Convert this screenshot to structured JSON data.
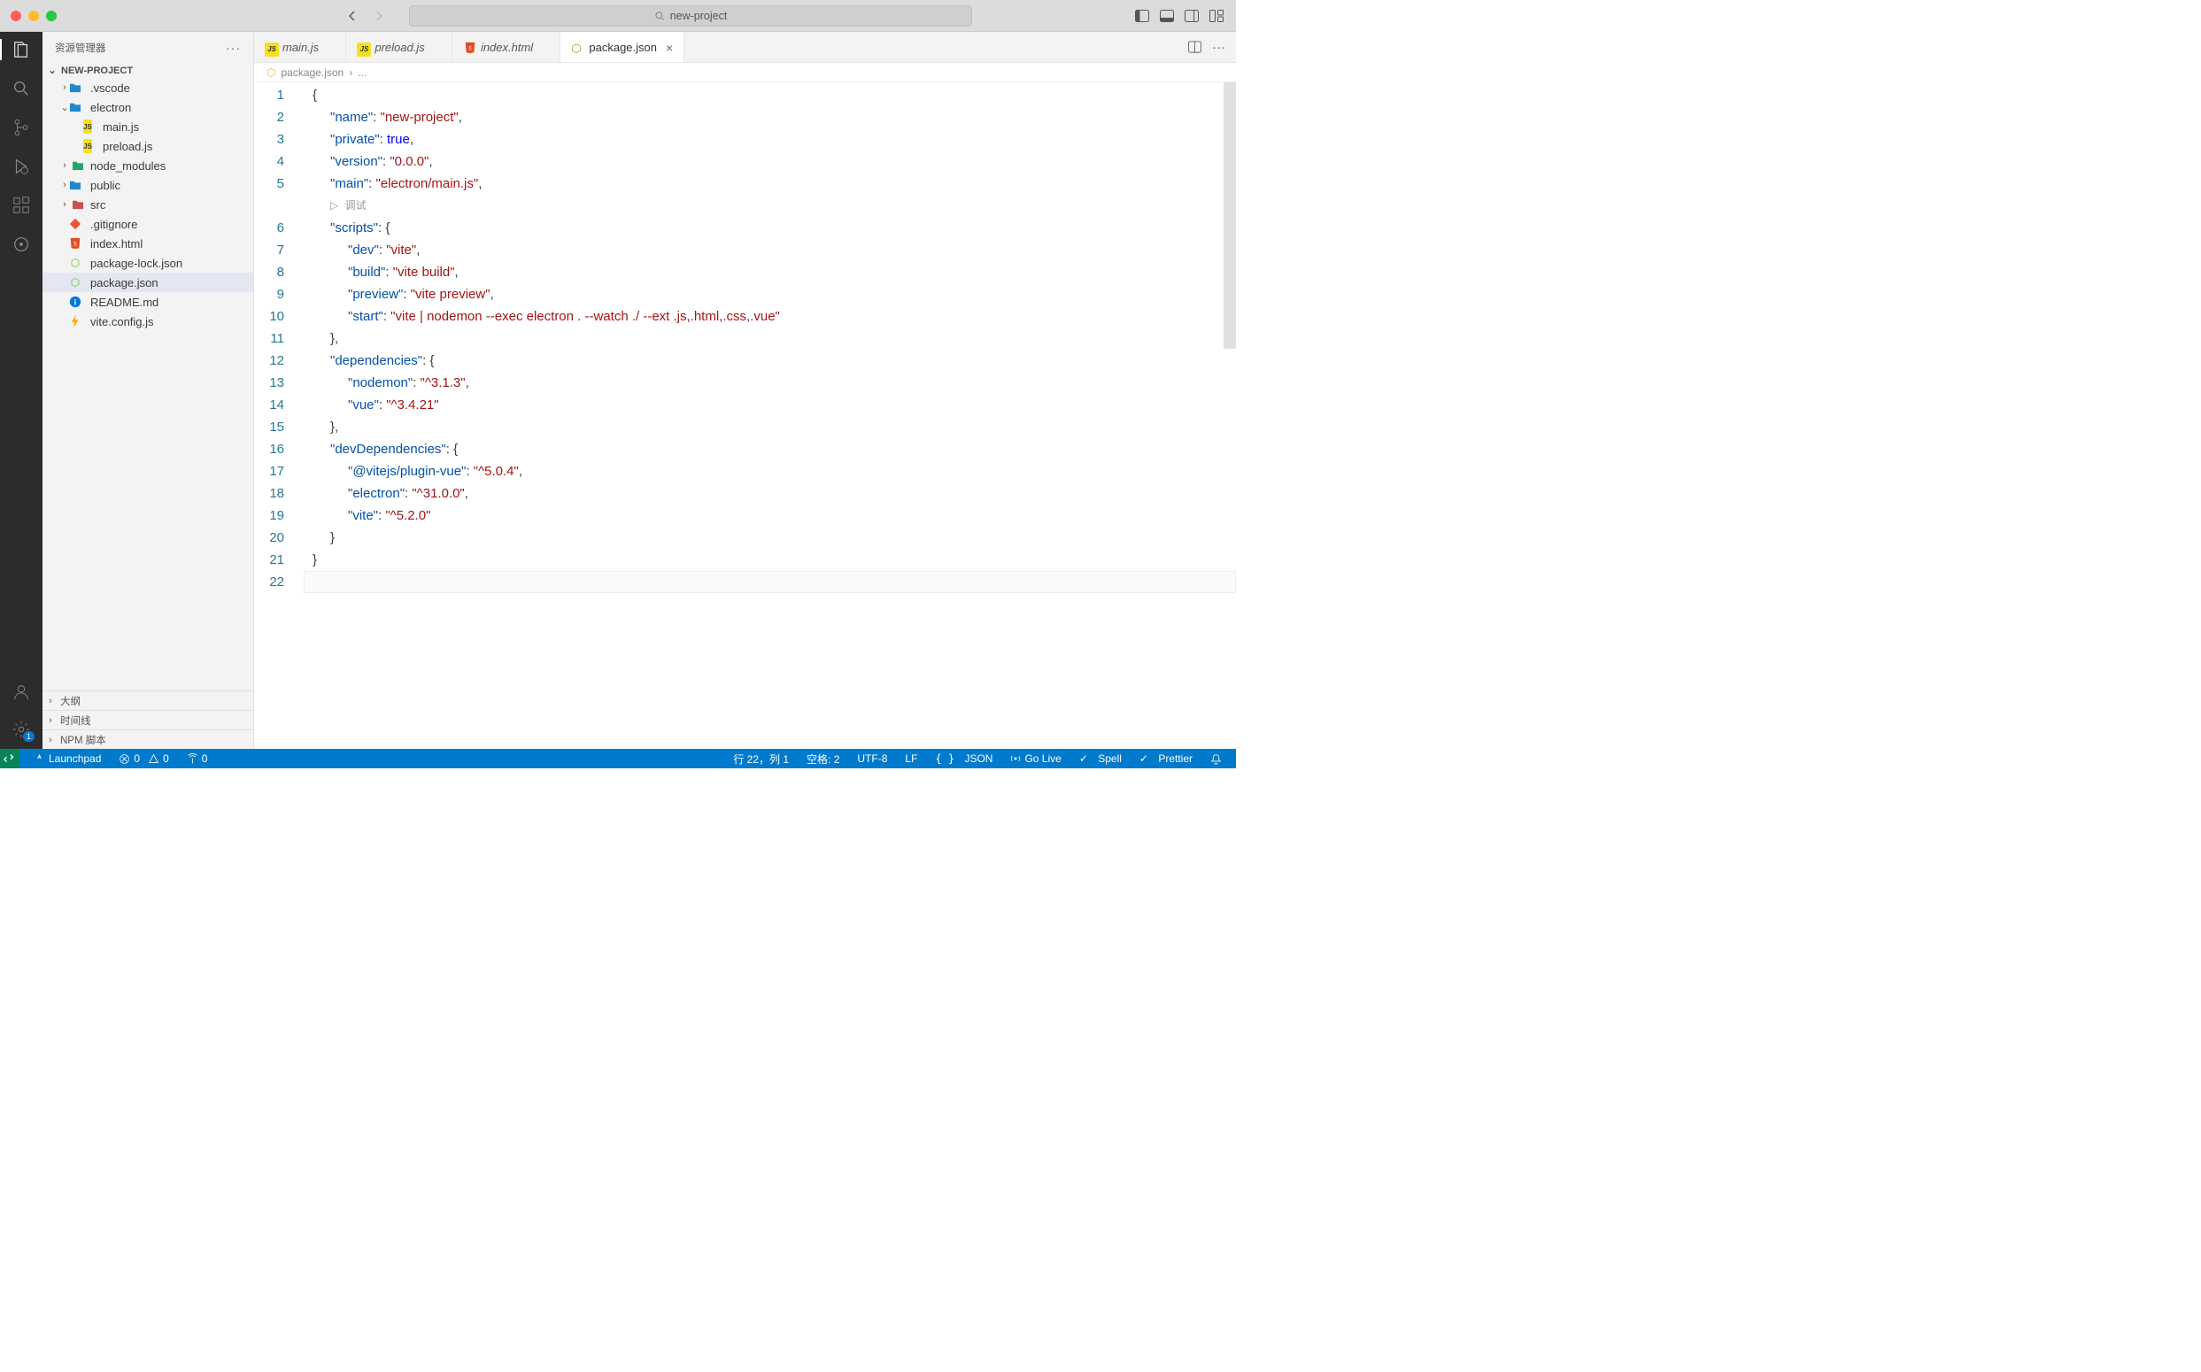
{
  "title": "new-project",
  "searchPlaceholder": "new-project",
  "sidebar": {
    "title": "资源管理器",
    "project": "NEW-PROJECT",
    "items": [
      {
        "label": ".vscode",
        "icon": "folder",
        "indent": 1,
        "chev": ">"
      },
      {
        "label": "electron",
        "icon": "folder",
        "indent": 1,
        "chev": "v"
      },
      {
        "label": "main.js",
        "icon": "js",
        "indent": 2
      },
      {
        "label": "preload.js",
        "icon": "js",
        "indent": 2
      },
      {
        "label": "node_modules",
        "icon": "folder-green",
        "indent": 1,
        "chev": ">"
      },
      {
        "label": "public",
        "icon": "folder",
        "indent": 1,
        "chev": ">"
      },
      {
        "label": "src",
        "icon": "folder-red",
        "indent": 1,
        "chev": ">"
      },
      {
        "label": ".gitignore",
        "icon": "git",
        "indent": 1
      },
      {
        "label": "index.html",
        "icon": "html",
        "indent": 1
      },
      {
        "label": "package-lock.json",
        "icon": "json",
        "indent": 1
      },
      {
        "label": "package.json",
        "icon": "json",
        "indent": 1,
        "selected": true
      },
      {
        "label": "README.md",
        "icon": "md",
        "indent": 1
      },
      {
        "label": "vite.config.js",
        "icon": "vite",
        "indent": 1
      }
    ],
    "panels": [
      "大纲",
      "时间线",
      "NPM 脚本"
    ]
  },
  "tabs": [
    {
      "label": "main.js",
      "icon": "js"
    },
    {
      "label": "preload.js",
      "icon": "js"
    },
    {
      "label": "index.html",
      "icon": "html"
    },
    {
      "label": "package.json",
      "icon": "json",
      "active": true
    }
  ],
  "breadcrumb": {
    "file": "package.json",
    "rest": "..."
  },
  "codelens": "调试",
  "code": {
    "lines": 22,
    "content": {
      "name": "new-project",
      "private": true,
      "version": "0.0.0",
      "main": "electron/main.js",
      "scripts": {
        "dev": "vite",
        "build": "vite build",
        "preview": "vite preview",
        "start": "vite | nodemon --exec electron . --watch ./ --ext .js,.html,.css,.vue"
      },
      "dependencies": {
        "nodemon": "^3.1.3",
        "vue": "^3.4.21"
      },
      "devDependencies": {
        "@vitejs/plugin-vue": "^5.0.4",
        "electron": "^31.0.0",
        "vite": "^5.2.0"
      }
    }
  },
  "status": {
    "launchpad": "Launchpad",
    "errors": "0",
    "warnings": "0",
    "ports": "0",
    "cursor": "行 22，列 1",
    "spaces": "空格: 2",
    "encoding": "UTF-8",
    "eol": "LF",
    "lang": "JSON",
    "golive": "Go Live",
    "spell": "Spell",
    "prettier": "Prettier"
  }
}
